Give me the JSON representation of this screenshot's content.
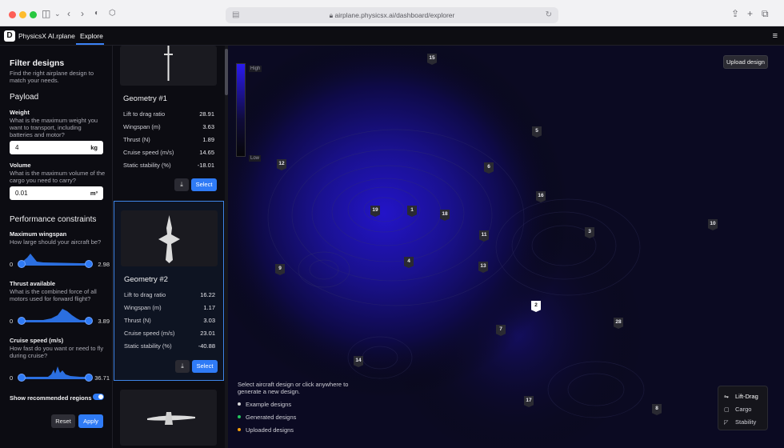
{
  "browser": {
    "url": "airplane.physicsx.ai/dashboard/explorer",
    "icons": [
      "sidebar-icon",
      "back-icon",
      "forward-icon",
      "privacy-icon",
      "extension-icon",
      "share-icon",
      "new-tab-icon",
      "tabs-icon",
      "reload-icon",
      "lock-icon"
    ]
  },
  "app": {
    "logo": "D",
    "name": "PhysicsX AI.rplane",
    "nav_tab": "Explore",
    "menu_icon": "hamburger-icon"
  },
  "filter": {
    "title": "Filter designs",
    "subtitle": "Find the right airplane design to match your needs.",
    "payload_title": "Payload",
    "weight_label": "Weight",
    "weight_desc": "What is the maximum weight you want to transport, including batteries and motor?",
    "weight_value": "4",
    "weight_unit": "kg",
    "volume_label": "Volume",
    "volume_desc": "What is the maximum volume of the cargo you need to carry?",
    "volume_value": "0.01",
    "volume_unit": "m³",
    "perf_title": "Performance constraints",
    "wingspan_label": "Maximum wingspan",
    "wingspan_desc": "How large should your aircraft be?",
    "wingspan_min": "0",
    "wingspan_max": "2.98",
    "thrust_label": "Thrust available",
    "thrust_desc": "What is the combined force of all motors used for forward flight?",
    "thrust_min": "0",
    "thrust_max": "3.89",
    "cruise_label": "Cruise speed (m/s)",
    "cruise_desc": "How fast do you want or need to fly during cruise?",
    "cruise_min": "0",
    "cruise_max": "36.71",
    "toggle_label": "Show recommended regions",
    "toggle_on": true,
    "reset_label": "Reset",
    "apply_label": "Apply"
  },
  "designs": [
    {
      "name": "Geometry #1",
      "props": [
        {
          "label": "Lift to drag ratio",
          "value": "28.91"
        },
        {
          "label": "Wingspan (m)",
          "value": "3.63"
        },
        {
          "label": "Thrust (N)",
          "value": "1.89"
        },
        {
          "label": "Cruise speed (m/s)",
          "value": "14.65"
        },
        {
          "label": "Static stability (%)",
          "value": "-18.01"
        }
      ],
      "select_label": "Select",
      "download_icon": "download-icon"
    },
    {
      "name": "Geometry #2",
      "props": [
        {
          "label": "Lift to drag ratio",
          "value": "16.22"
        },
        {
          "label": "Wingspan (m)",
          "value": "1.17"
        },
        {
          "label": "Thrust (N)",
          "value": "3.03"
        },
        {
          "label": "Cruise speed (m/s)",
          "value": "23.01"
        },
        {
          "label": "Static stability (%)",
          "value": "-40.88"
        }
      ],
      "select_label": "Select",
      "download_icon": "download-icon"
    }
  ],
  "map": {
    "legend_high": "High",
    "legend_low": "Low",
    "upload_label": "Upload design",
    "hint": "Select aircraft design or click anywhere to generate a new design.",
    "legend_items": [
      {
        "label": "Example designs",
        "color": "#d9d9d9"
      },
      {
        "label": "Generated designs",
        "color": "#22c55e"
      },
      {
        "label": "Uploaded designs",
        "color": "#f59e0b"
      }
    ],
    "views": [
      {
        "label": "Lift-Drag",
        "icon": "lift-drag-icon",
        "glyph": "⇋",
        "active": true
      },
      {
        "label": "Cargo",
        "icon": "cargo-icon",
        "glyph": "▢",
        "active": false
      },
      {
        "label": "Stability",
        "icon": "stability-icon",
        "glyph": "◸",
        "active": false
      }
    ],
    "pins": [
      "15",
      "5",
      "12",
      "6",
      "16",
      "19",
      "1",
      "18",
      "3",
      "10",
      "11",
      "4",
      "13",
      "9",
      "2",
      "28",
      "7",
      "14",
      "17",
      "8"
    ]
  }
}
